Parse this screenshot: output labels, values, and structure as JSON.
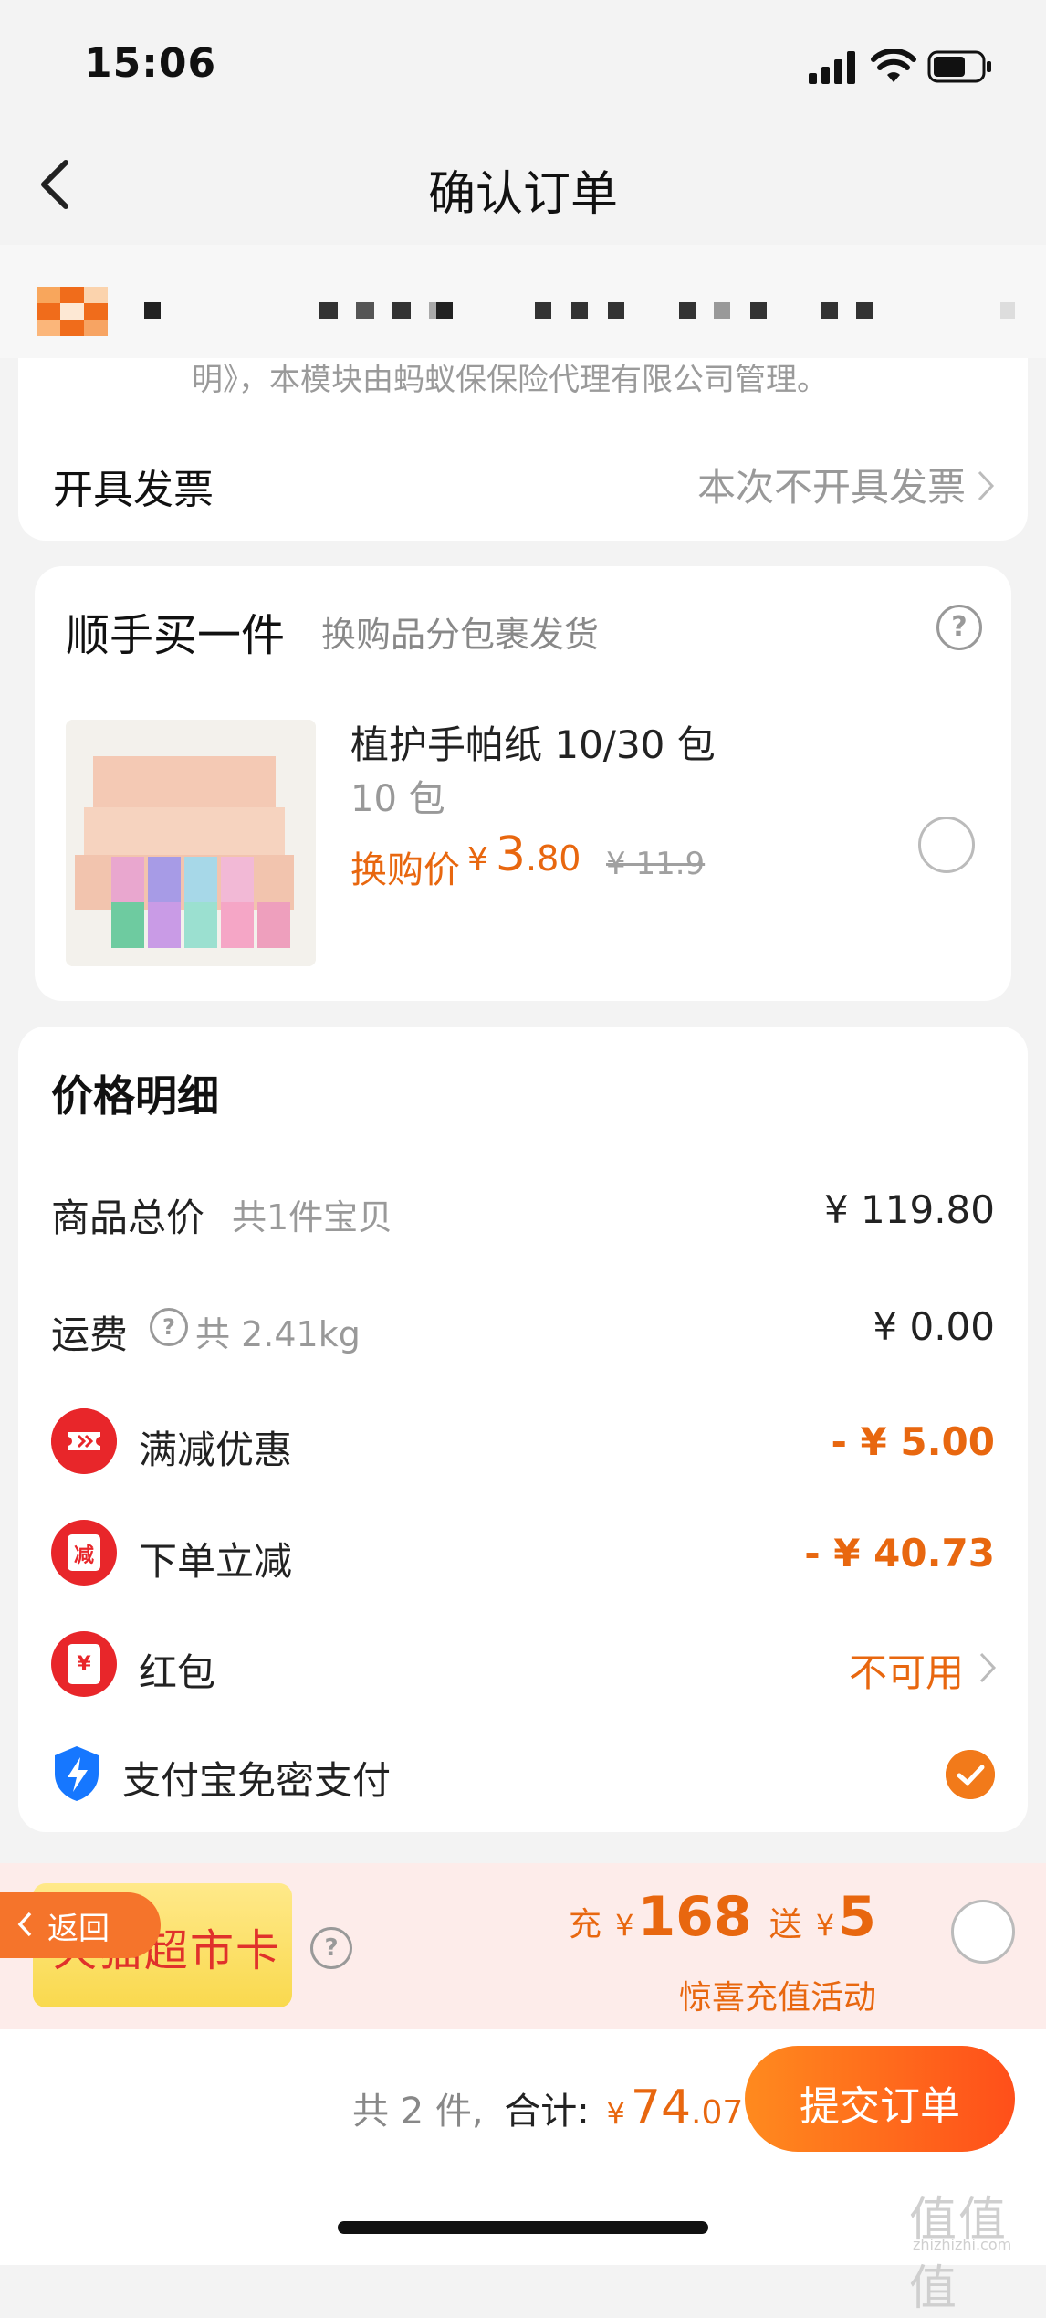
{
  "status_bar": {
    "time": "15:06"
  },
  "nav": {
    "title": "确认订单"
  },
  "top_card": {
    "faded_text": "明》，本模块由蚂蚁保保险代理有限公司管理。",
    "invoice_label": "开具发票",
    "invoice_value": "本次不开具发票"
  },
  "addon": {
    "title": "顺手买一件",
    "subtitle": "换购品分包裹发货",
    "help": "?",
    "product_name": "植护手帕纸 10/30 包",
    "product_spec": "10 包",
    "price_label": "换购价",
    "price_currency": "¥",
    "price_int": "3",
    "price_dec": ".80",
    "old_price": "¥ 11.9"
  },
  "price_detail": {
    "title": "价格明细",
    "goods_label": "商品总价",
    "goods_sub": "共1件宝贝",
    "goods_value": "¥ 119.80",
    "shipping_label": "运费",
    "shipping_sub": "共 2.41kg",
    "shipping_value": "¥ 0.00",
    "discount1_label": "满减优惠",
    "discount1_value": "- ¥ 5.00",
    "discount2_label": "下单立减",
    "discount2_icon_text": "减",
    "discount2_value": "- ¥ 40.73",
    "hongbao_label": "红包",
    "hongbao_icon_text": "¥",
    "hongbao_value": "不可用",
    "alipay_label": "支付宝免密支付"
  },
  "tmall": {
    "card_text": "天猫超市卡",
    "back_label": "返回",
    "charge_prefix": "充",
    "currency": "¥",
    "charge_amount": "168",
    "give_prefix": "送",
    "give_amount": "5",
    "promo_sub": "惊喜充值活动"
  },
  "footer": {
    "count_text": "共 2 件,",
    "total_label": "合计:",
    "currency": "¥",
    "total_int": "74",
    "total_dec": ".07",
    "submit_label": "提交订单"
  },
  "watermark": {
    "main": "值值值",
    "sub": "zhizhizhi.com"
  },
  "colors": {
    "accent": "#e8670f",
    "red": "#e8262a",
    "submit_start": "#ff8a1e",
    "submit_end": "#ff4f1a"
  }
}
